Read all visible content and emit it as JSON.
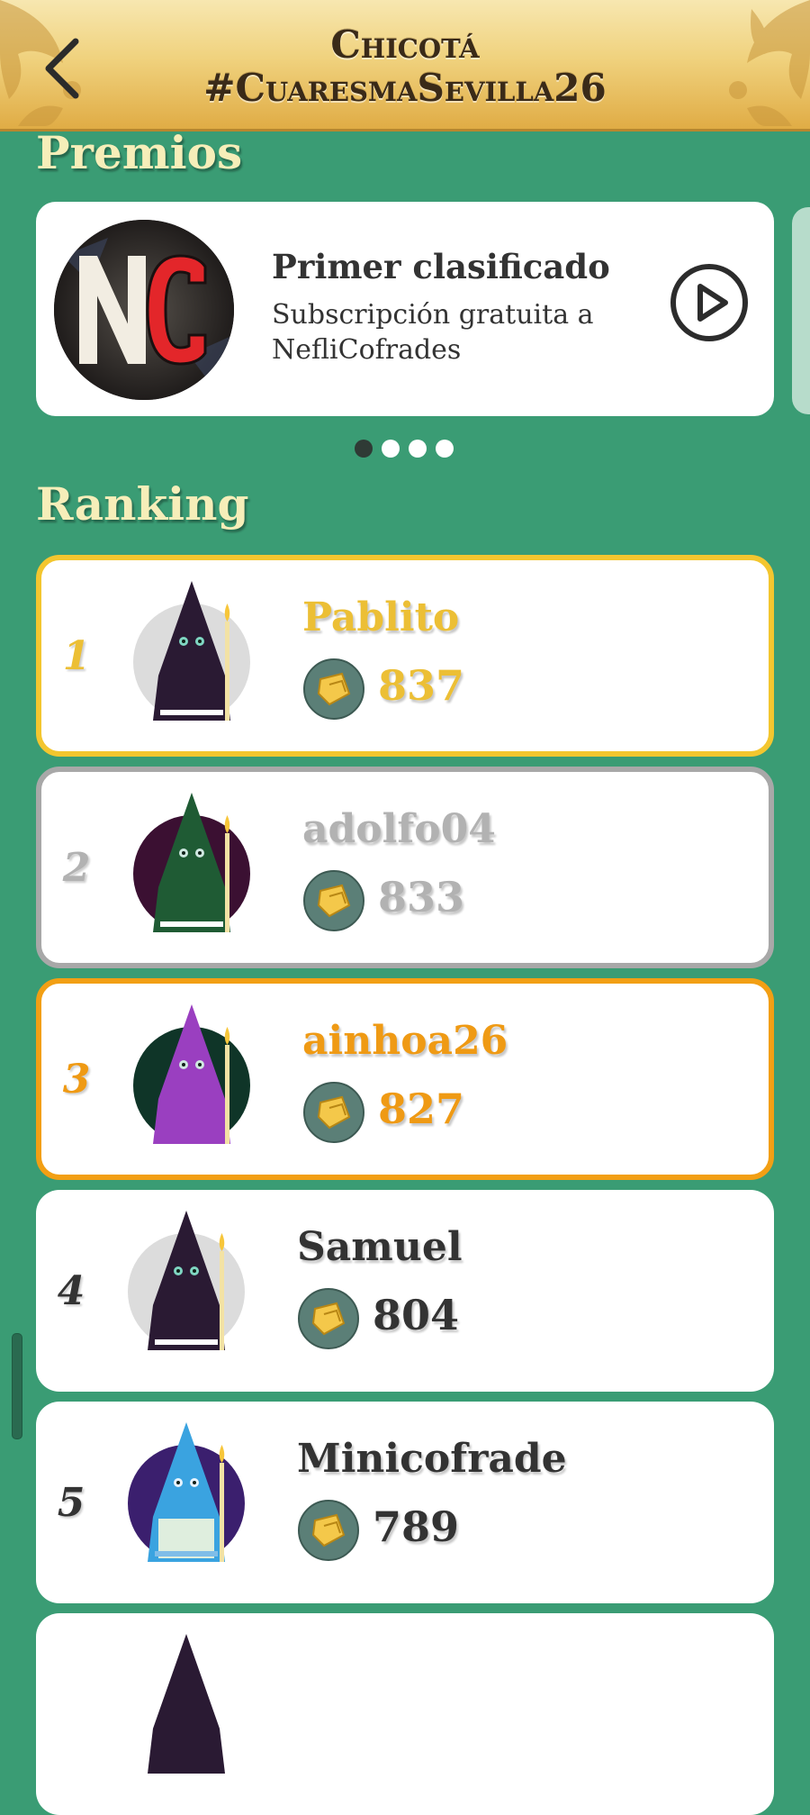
{
  "header": {
    "title_line1": "Chicotá",
    "title_line2": "#CuaresmaSevilla26"
  },
  "prizes": {
    "section_title": "Premios",
    "items": [
      {
        "title": "Primer clasificado",
        "description": "Subscripción gratuita a NefliCofrades",
        "logo_text": "NC"
      }
    ],
    "pagination": {
      "total": 4,
      "active_index": 0
    }
  },
  "ranking": {
    "section_title": "Ranking",
    "entries": [
      {
        "position": "1",
        "name": "Pablito",
        "score": "837",
        "style": "gold"
      },
      {
        "position": "2",
        "name": "adolfo04",
        "score": "833",
        "style": "silver"
      },
      {
        "position": "3",
        "name": "ainhoa26",
        "score": "827",
        "style": "bronze"
      },
      {
        "position": "4",
        "name": "Samuel",
        "score": "804",
        "style": "default"
      },
      {
        "position": "5",
        "name": "Minicofrade",
        "score": "789",
        "style": "default"
      }
    ]
  },
  "colors": {
    "background": "#3a9c74",
    "header_gold": "#e0ac45",
    "gold": "#f3c62f",
    "silver": "#a8a8a8",
    "bronze": "#f29f14",
    "text_dark": "#333333"
  },
  "icons": {
    "back": "chevron-left-icon",
    "play": "play-icon",
    "score": "candle-wax-icon"
  }
}
